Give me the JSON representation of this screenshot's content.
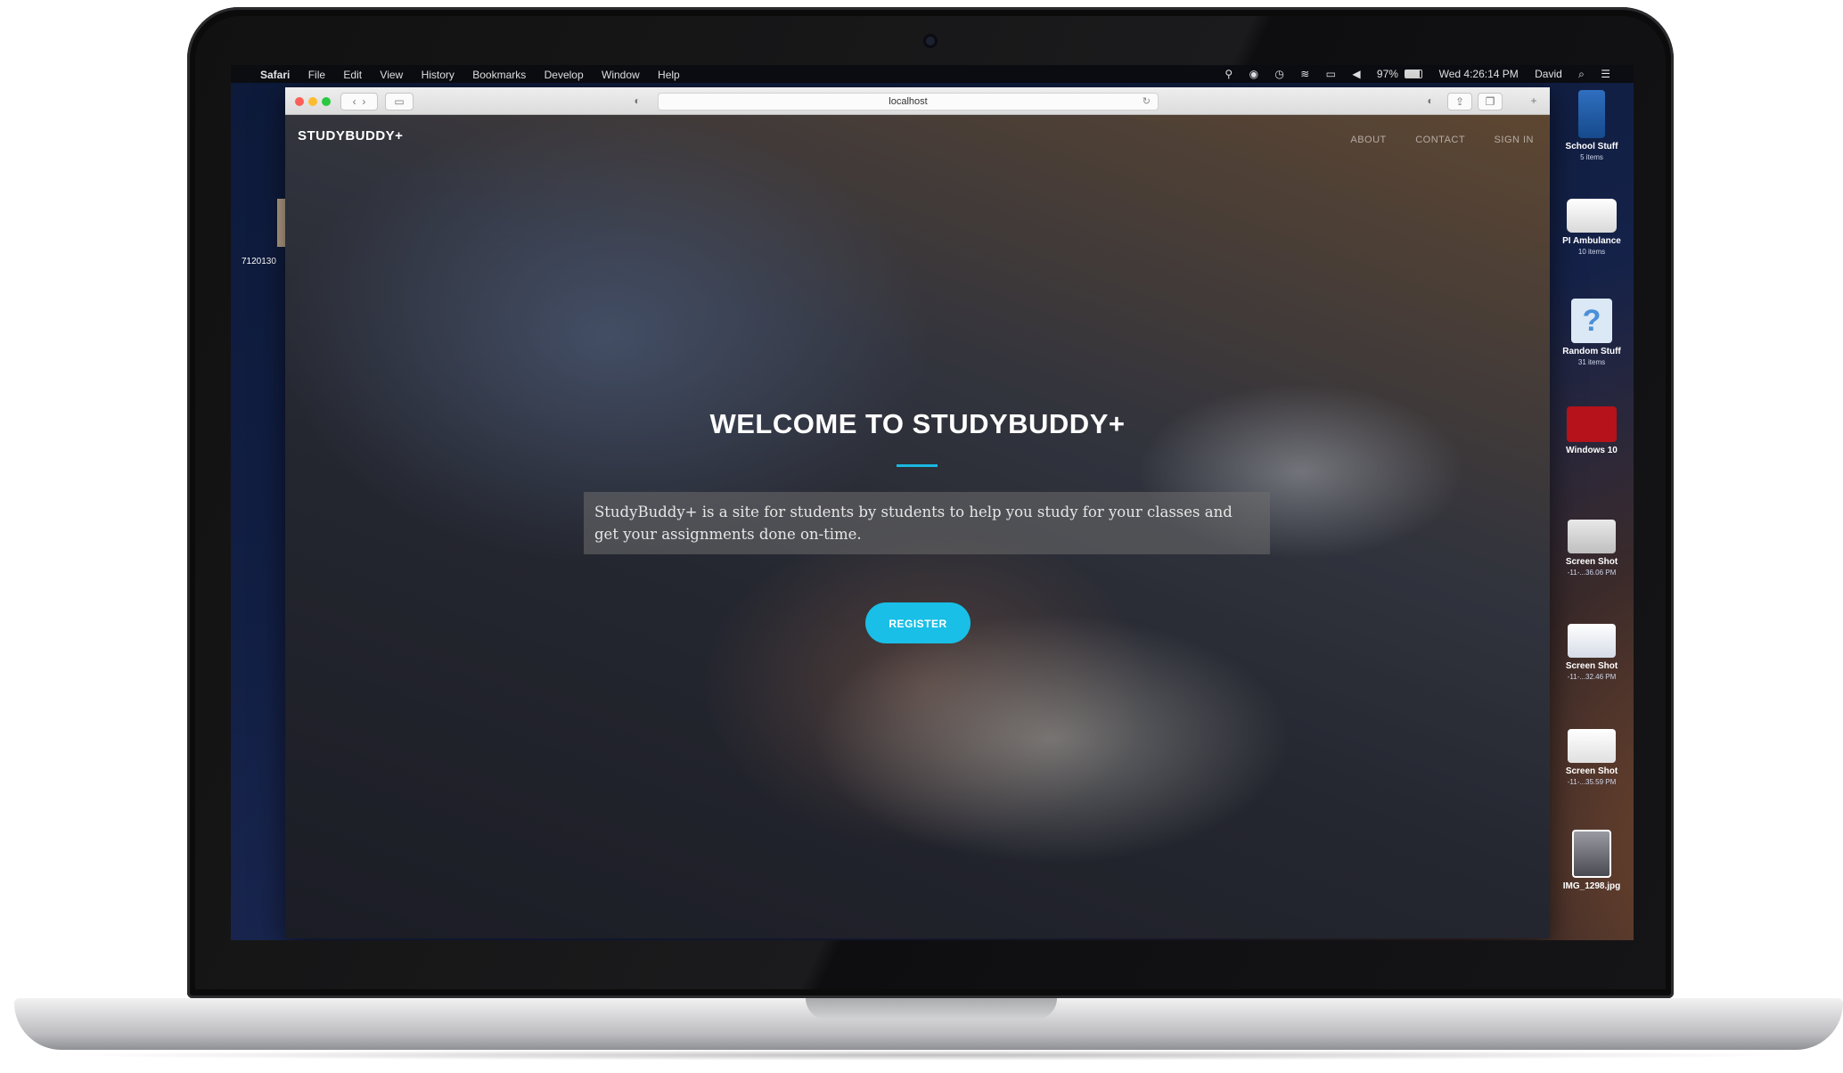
{
  "menubar": {
    "apple": "",
    "app_name": "Safari",
    "menus": [
      "File",
      "Edit",
      "View",
      "History",
      "Bookmarks",
      "Develop",
      "Window",
      "Help"
    ],
    "battery": "97%",
    "datetime": "Wed 4:26:14 PM",
    "user": "David"
  },
  "browser": {
    "url": "localhost"
  },
  "site": {
    "brand": "STUDYBUDDY+",
    "nav": [
      "ABOUT",
      "CONTACT",
      "SIGN IN"
    ],
    "hero_title": "WELCOME TO STUDYBUDDY+",
    "hero_description": "StudyBuddy+ is a site for students by students to help you study for your classes and get your assignments done on-time.",
    "register_label": "REGISTER",
    "accent_color": "#19bfe6"
  },
  "desktop": {
    "left_label": "7120130",
    "icons": [
      {
        "label": "School Stuff",
        "sub": "5 items",
        "icon": "tardis-icon"
      },
      {
        "label": "PI Ambulance",
        "sub": "10 items",
        "icon": "ambulance-icon"
      },
      {
        "label": "Random Stuff",
        "sub": "31 items",
        "icon": "question-icon"
      },
      {
        "label": "Windows 10",
        "sub": "",
        "icon": "parallels-icon"
      },
      {
        "label": "Screen Shot",
        "sub": "-11-...36.06 PM",
        "icon": "screenshot-icon"
      },
      {
        "label": "Screen Shot",
        "sub": "-11-...32.46 PM",
        "icon": "screenshot-icon"
      },
      {
        "label": "Screen Shot",
        "sub": "-11-...35.59 PM",
        "icon": "screenshot-icon"
      },
      {
        "label": "IMG_1298.jpg",
        "sub": "",
        "icon": "photo-icon"
      }
    ]
  }
}
